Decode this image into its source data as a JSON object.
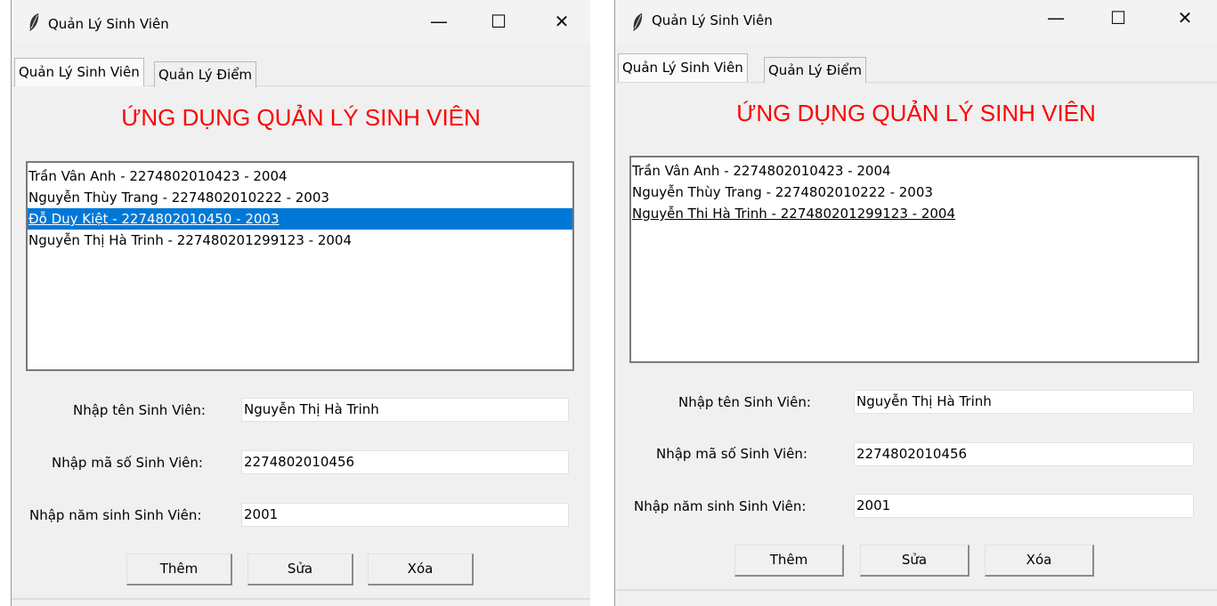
{
  "window_title": "Quản Lý Sinh Viên",
  "controls": {
    "minimize": "—",
    "maximize": "☐",
    "close": "✕"
  },
  "tabs": [
    "Quản Lý Sinh Viên",
    "Quản Lý Điểm"
  ],
  "heading": "ỨNG DỤNG QUẢN LÝ SINH VIÊN",
  "colors": {
    "heading": "#ff0000",
    "selection": "#0078d7",
    "window_bg": "#f0f0f0"
  },
  "labels": {
    "name": "Nhập tên Sinh Viên:",
    "id": "Nhập mã số Sinh Viên:",
    "year": "Nhập năm sinh Sinh Viên:"
  },
  "buttons": {
    "add": "Thêm",
    "edit": "Sửa",
    "delete": "Xóa"
  },
  "windows": [
    {
      "students": [
        "Trần Vân Anh - 2274802010423 - 2004",
        "Nguyễn Thùy Trang - 2274802010222 - 2003",
        "Đỗ Duy Kiệt  - 2274802010450 - 2003",
        "Nguyễn Thị Hà Trinh - 227480201299123 - 2004"
      ],
      "selected_index": 2,
      "inputs": {
        "name": "Nguyễn Thị Hà Trinh",
        "id": "2274802010456",
        "year": "2001"
      }
    },
    {
      "students": [
        "Trần Vân Anh - 2274802010423 - 2004",
        "Nguyễn Thùy Trang - 2274802010222 - 2003",
        "Nguyễn Thi Hà Trinh - 227480201299123 - 2004"
      ],
      "active_index": 2,
      "inputs": {
        "name": "Nguyễn Thị Hà Trinh",
        "id": "2274802010456",
        "year": "2001"
      }
    }
  ]
}
